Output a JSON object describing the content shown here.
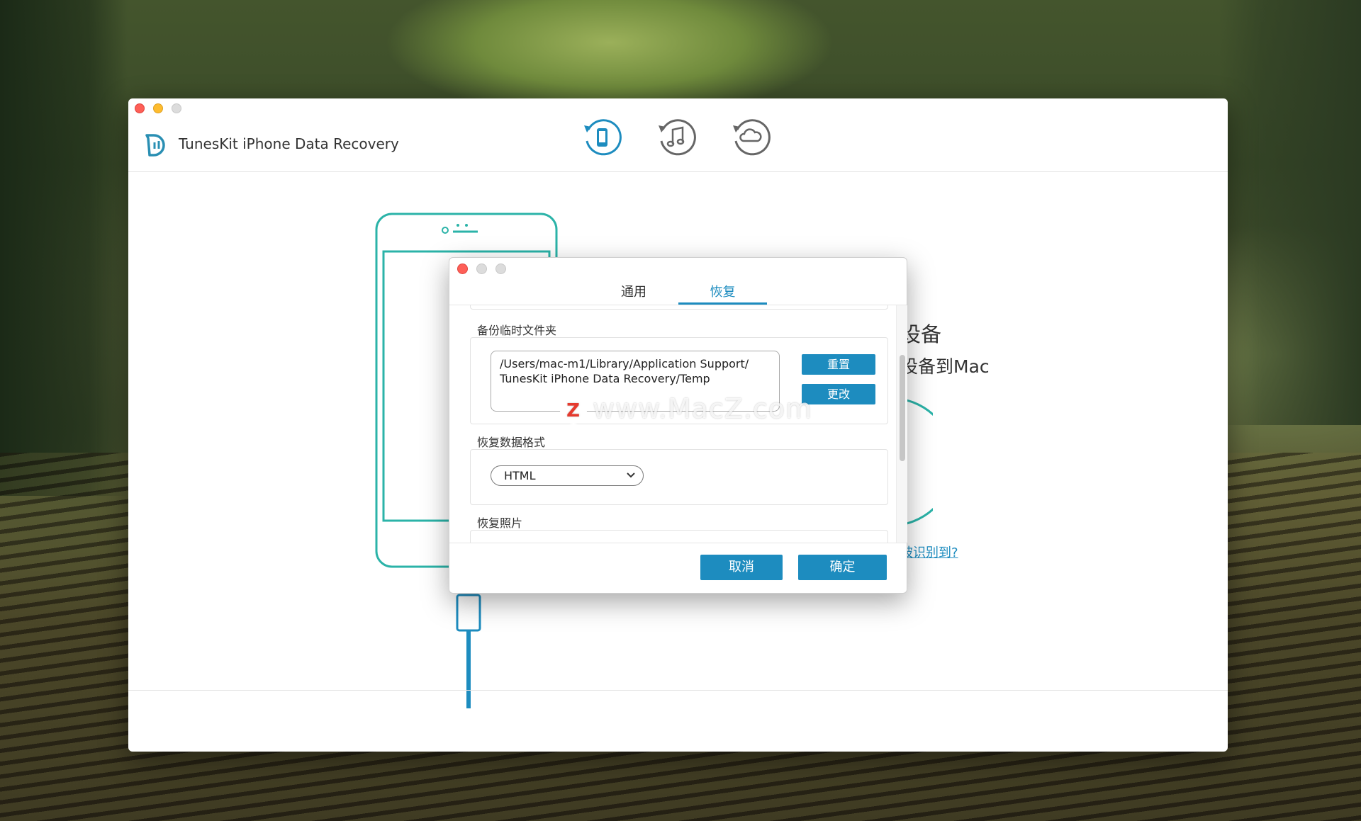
{
  "app": {
    "title": "TunesKit iPhone Data Recovery",
    "modes": [
      "recover-from-device",
      "recover-from-itunes",
      "recover-from-icloud"
    ],
    "accent_color": "#1d8cbf"
  },
  "background_page": {
    "heading_partial": "设备",
    "subheading_partial": "设备到Mac",
    "link_partial": "被识别到?"
  },
  "dialog": {
    "tabs": [
      {
        "label": "通用",
        "active": false
      },
      {
        "label": "恢复",
        "active": true
      }
    ],
    "backup_temp_folder": {
      "label": "备份临时文件夹",
      "path": "/Users/mac-m1/Library/Application Support/\nTunesKit iPhone Data Recovery/Temp",
      "reset_label": "重置",
      "change_label": "更改"
    },
    "recover_format": {
      "label": "恢复数据格式",
      "selected": "HTML"
    },
    "recover_photos": {
      "label": "恢复照片"
    },
    "cancel_label": "取消",
    "ok_label": "确定"
  },
  "watermark": {
    "letter": "Z",
    "text": "www.MacZ.com"
  }
}
